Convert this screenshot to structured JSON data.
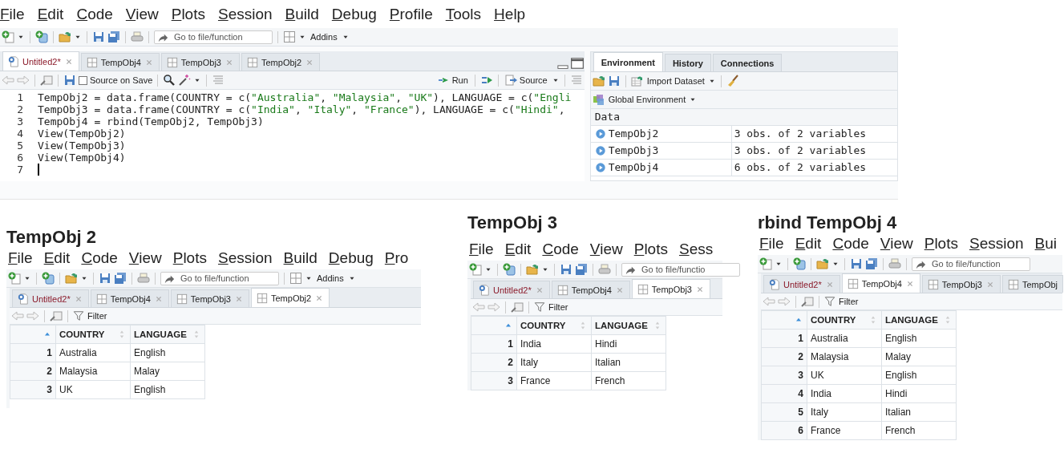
{
  "main": {
    "menu": [
      "File",
      "Edit",
      "Code",
      "View",
      "Plots",
      "Session",
      "Build",
      "Debug",
      "Profile",
      "Tools",
      "Help"
    ],
    "toolbar": {
      "placeholder": "Go to file/function",
      "addins": "Addins"
    },
    "source": {
      "tabs": [
        {
          "label": "Untitled2*",
          "kind": "script",
          "selected": true
        },
        {
          "label": "TempObj4",
          "kind": "data",
          "selected": false
        },
        {
          "label": "TempObj3",
          "kind": "data",
          "selected": false
        },
        {
          "label": "TempObj2",
          "kind": "data",
          "selected": false
        }
      ],
      "toolbar": {
        "source_on_save": "Source on Save",
        "checked": false,
        "run": "Run",
        "source": "Source"
      },
      "lines": [
        {
          "number": "1",
          "code": "TempObj2 = data.frame(COUNTRY = c(\"Australia\", \"Malaysia\", \"UK\"), LANGUAGE = c(\"Engli"
        },
        {
          "number": "2",
          "code": "TempObj3 = data.frame(COUNTRY = c(\"India\", \"Italy\", \"France\"), LANGUAGE = c(\"Hindi\","
        },
        {
          "number": "3",
          "code": "TempObj4 = rbind(TempObj2, TempObj3)"
        },
        {
          "number": "4",
          "code": "View(TempObj2)"
        },
        {
          "number": "5",
          "code": "View(TempObj3)"
        },
        {
          "number": "6",
          "code": "View(TempObj4)"
        },
        {
          "number": "7"
        }
      ]
    },
    "environment": {
      "tabs": [
        {
          "label": "Environment",
          "selected": true
        },
        {
          "label": "History",
          "selected": false
        },
        {
          "label": "Connections",
          "selected": false
        }
      ],
      "import": "Import Dataset",
      "scope": "Global Environment",
      "section": "Data",
      "objects": [
        {
          "name": "TempObj2",
          "summary": "3 obs. of 2 variables"
        },
        {
          "name": "TempObj3",
          "summary": "3 obs. of 2 variables"
        },
        {
          "name": "TempObj4",
          "summary": "6 obs. of 2 variables"
        }
      ]
    }
  },
  "panels": [
    {
      "heading": "TempObj 2",
      "menu": [
        "File",
        "Edit",
        "Code",
        "View",
        "Plots",
        "Session",
        "Build",
        "Debug",
        "Pro"
      ],
      "toolbar": {
        "placeholder": "Go to file/function",
        "addins": "Addins"
      },
      "tabs": [
        {
          "label": "Untitled2*",
          "kind": "script",
          "selected": false
        },
        {
          "label": "TempObj4",
          "kind": "data",
          "selected": false
        },
        {
          "label": "TempObj3",
          "kind": "data",
          "selected": false
        },
        {
          "label": "TempObj2",
          "kind": "data",
          "selected": true
        }
      ],
      "filter": "Filter",
      "columns": [
        "COUNTRY",
        "LANGUAGE"
      ],
      "rows": [
        {
          "number": "1",
          "cells": [
            "Australia",
            "English"
          ]
        },
        {
          "number": "2",
          "cells": [
            "Malaysia",
            "Malay"
          ]
        },
        {
          "number": "3",
          "cells": [
            "UK",
            "English"
          ]
        }
      ]
    },
    {
      "heading": "TempObj 3",
      "menu": [
        "File",
        "Edit",
        "Code",
        "View",
        "Plots",
        "Sess"
      ],
      "toolbar": {
        "placeholder": "Go to file/functio"
      },
      "tabs": [
        {
          "label": "Untitled2*",
          "kind": "script",
          "selected": false
        },
        {
          "label": "TempObj4",
          "kind": "data",
          "selected": false
        },
        {
          "label": "TempObj3",
          "kind": "data",
          "selected": true
        }
      ],
      "filter": "Filter",
      "columns": [
        "COUNTRY",
        "LANGUAGE"
      ],
      "rows": [
        {
          "number": "1",
          "cells": [
            "India",
            "Hindi"
          ]
        },
        {
          "number": "2",
          "cells": [
            "Italy",
            "Italian"
          ]
        },
        {
          "number": "3",
          "cells": [
            "France",
            "French"
          ]
        }
      ]
    },
    {
      "heading": "rbind TempObj 4",
      "menu": [
        "File",
        "Edit",
        "Code",
        "View",
        "Plots",
        "Session",
        "Bui"
      ],
      "toolbar": {
        "placeholder": "Go to file/function"
      },
      "tabs": [
        {
          "label": "Untitled2*",
          "kind": "script",
          "selected": false
        },
        {
          "label": "TempObj4",
          "kind": "data",
          "selected": true
        },
        {
          "label": "TempObj3",
          "kind": "data",
          "selected": false
        },
        {
          "label": "TempObj",
          "kind": "data",
          "selected": false
        }
      ],
      "filter": "Filter",
      "columns": [
        "COUNTRY",
        "LANGUAGE"
      ],
      "rows": [
        {
          "number": "1",
          "cells": [
            "Australia",
            "English"
          ]
        },
        {
          "number": "2",
          "cells": [
            "Malaysia",
            "Malay"
          ]
        },
        {
          "number": "3",
          "cells": [
            "UK",
            "English"
          ]
        },
        {
          "number": "4",
          "cells": [
            "India",
            "Hindi"
          ]
        },
        {
          "number": "5",
          "cells": [
            "Italy",
            "Italian"
          ]
        },
        {
          "number": "6",
          "cells": [
            "France",
            "French"
          ]
        }
      ]
    }
  ]
}
